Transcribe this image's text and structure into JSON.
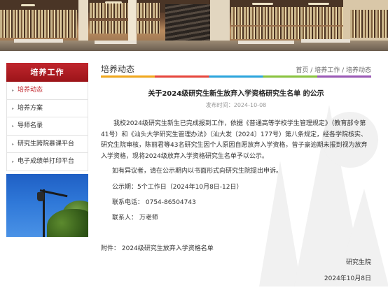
{
  "sidebar": {
    "title": "培养工作",
    "items": [
      {
        "label": "培养动态",
        "active": true
      },
      {
        "label": "培养方案",
        "active": false
      },
      {
        "label": "导师名录",
        "active": false
      },
      {
        "label": "研究生跨院慕课平台",
        "active": false
      },
      {
        "label": "电子成绩单打印平台",
        "active": false
      }
    ],
    "arrow_icon": "▸"
  },
  "section": {
    "title": "培养动态",
    "breadcrumb": [
      "首页",
      "培养工作",
      "培养动态"
    ],
    "breadcrumb_sep": " / "
  },
  "article": {
    "title": "关于2024级研究生新生放弃入学资格研究生名单 的公示",
    "pubdate_label": "发布时间：",
    "pubdate": "2024-10-08",
    "body": "我校2024级研究生新生已完成报到工作，依据《普通高等学校学生管理规定》（教育部令第41号）和《汕头大学研究生管理办法》（汕大发〔2024〕177号）第八条规定，经各学院核实、研究生院审核，陈丽君等43名研究生因个人原因自愿放弃入学资格，曾子豪逾期未报到视为放弃入学资格，现将2024级放弃入学资格研究生名单予以公示。",
    "objection": "如有异议者，请在公示期内以书面形式向研究生院提出申诉。",
    "period": "公示期：5个工作日（2024年10月8日-12日）",
    "phone": "联系电话：  0754-86504743",
    "contact": "联系人：  万老师",
    "attachment": "附件：  2024级研究生放弃入学资格名单",
    "signature": "研究生院",
    "date": "2024年10月8日"
  },
  "colors": {
    "accent_red": "#c0262d",
    "bar": [
      "#f2a81c",
      "#e8463c",
      "#2ba6de",
      "#8ac43f",
      "#9b59b6"
    ]
  }
}
